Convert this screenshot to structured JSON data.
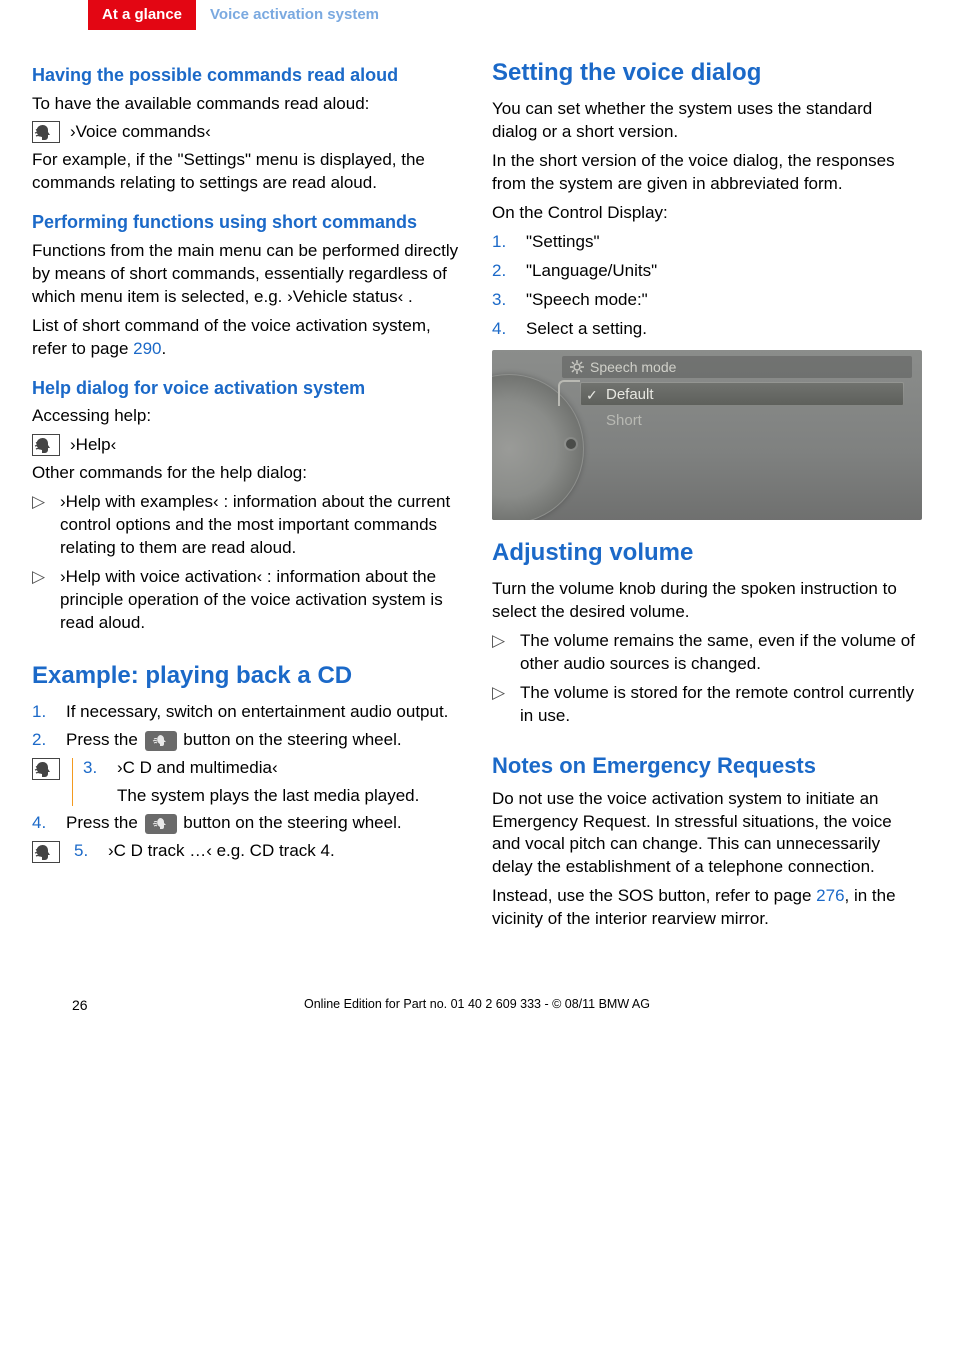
{
  "header": {
    "active": "At a glance",
    "inactive": "Voice activation system"
  },
  "left": {
    "sec1": {
      "title": "Having the possible commands read aloud",
      "p1": "To have the available commands read aloud:",
      "voice_cmd": "›Voice commands‹",
      "p2": "For example, if the \"Settings\" menu is displayed, the commands relating to settings are read aloud."
    },
    "sec2": {
      "title": "Performing functions using short commands",
      "p1": "Functions from the main menu can be performed directly by means of short commands, essentially regardless of which menu item is selected, e.g. ›Vehicle status‹ .",
      "p2a": "List of short command of the voice activation system, refer to page ",
      "p2_link": "290",
      "p2b": "."
    },
    "sec3": {
      "title": "Help dialog for voice activation system",
      "p1": "Accessing help:",
      "voice_cmd": "›Help‹",
      "p2": "Other commands for the help dialog:",
      "b1": "›Help with examples‹ : information about the current control options and the most important commands relating to them are read aloud.",
      "b2": "›Help with voice activation‹ : information about the principle operation of the voice activation system is read aloud."
    },
    "sec4": {
      "title": "Example: playing back a CD",
      "s1": "If necessary, switch on entertainment audio output.",
      "s2a": "Press the ",
      "s2b": " button on the steering wheel.",
      "s3": "›C D and multimedia‹",
      "s3sub": "The system plays the last media played.",
      "s4a": "Press the ",
      "s4b": " button on the steering wheel.",
      "s5": "›C D track …‹  e.g. CD track 4."
    }
  },
  "right": {
    "sec1": {
      "title": "Setting the voice dialog",
      "p1": "You can set whether the system uses the standard dialog or a short version.",
      "p2": "In the short version of the voice dialog, the responses from the system are given in abbreviated form.",
      "p3": "On the Control Display:",
      "s1": "\"Settings\"",
      "s2": "\"Language/Units\"",
      "s3": "\"Speech mode:\"",
      "s4": "Select a setting.",
      "ss_title": "Speech mode",
      "ss_row1": "Default",
      "ss_row2": "Short"
    },
    "sec2": {
      "title": "Adjusting volume",
      "p1": "Turn the volume knob during the spoken instruction to select the desired volume.",
      "b1": "The volume remains the same, even if the volume of other audio sources is changed.",
      "b2": "The volume is stored for the remote control currently in use."
    },
    "sec3": {
      "title": "Notes on Emergency Requests",
      "p1": "Do not use the voice activation system to initiate an Emergency Request. In stressful situations, the voice and vocal pitch can change. This can unnecessarily delay the establishment of a telephone connection.",
      "p2a": "Instead, use the SOS button, refer to page ",
      "p2_link": "276",
      "p2b": ", in the vicinity of the interior rearview mirror."
    }
  },
  "footer": {
    "page": "26",
    "text": "Online Edition for Part no. 01 40 2 609 333 - © 08/11 BMW AG"
  }
}
